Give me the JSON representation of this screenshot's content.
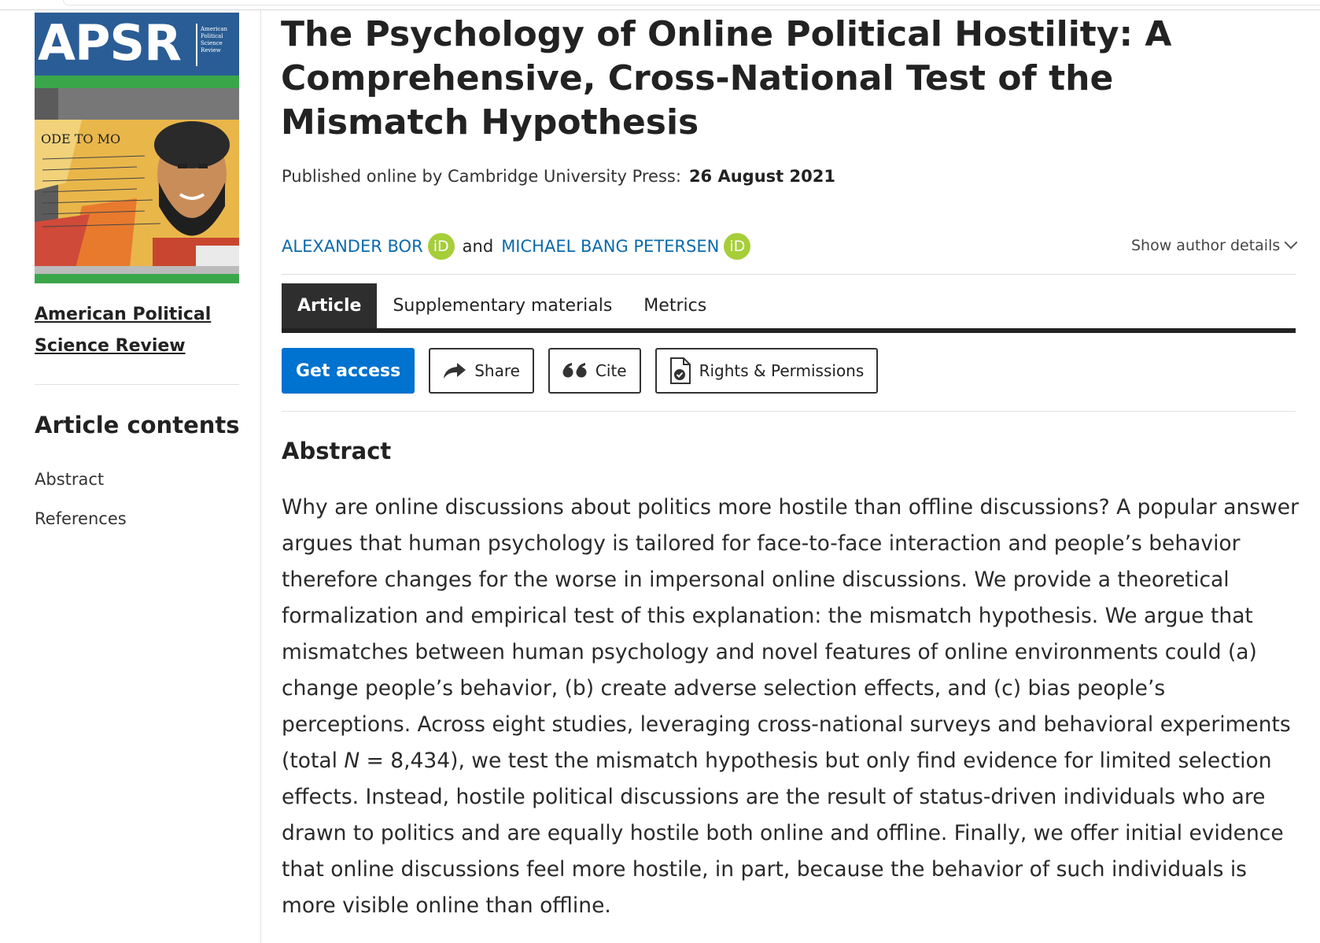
{
  "journal": {
    "cover_brand": "APSR",
    "cover_subtitle": "American Political Science Review",
    "name_line1": "American Political",
    "name_line2": "Science Review"
  },
  "sidebar": {
    "contents_heading": "Article contents",
    "items": [
      {
        "label": "Abstract"
      },
      {
        "label": "References"
      }
    ]
  },
  "article": {
    "title": "The Psychology of Online Political Hostility: A Comprehensive, Cross-National Test of the Mismatch Hypothesis",
    "published_label": "Published online by Cambridge University Press:",
    "published_date": "26 August 2021",
    "authors": [
      {
        "name": "ALEXANDER BOR",
        "orcid": "iD"
      },
      {
        "name": "MICHAEL BANG PETERSEN",
        "orcid": "iD"
      }
    ],
    "authors_joiner": "and",
    "show_author_details": "Show author details"
  },
  "tabs": [
    {
      "label": "Article",
      "active": true
    },
    {
      "label": "Supplementary materials",
      "active": false
    },
    {
      "label": "Metrics",
      "active": false
    }
  ],
  "actions": {
    "get_access": "Get access",
    "share": "Share",
    "cite": "Cite",
    "rights": "Rights & Permissions"
  },
  "abstract": {
    "heading": "Abstract",
    "text_before_n": "Why are online discussions about politics more hostile than offline discussions? A popular answer argues that human psychology is tailored for face-to-face interaction and people’s behavior therefore changes for the worse in impersonal online discussions. We provide a theoretical formalization and empirical test of this explanation: the mismatch hypothesis. We argue that mismatches between human psychology and novel features of online environments could (a) change people’s behavior, (b) create adverse selection effects, and (c) bias people’s perceptions. Across eight studies, leveraging cross-national surveys and behavioral experiments (total ",
    "n_symbol": "N",
    "text_after_n": " = 8,434), we test the mismatch hypothesis but only find evidence for limited selection effects. Instead, hostile political discussions are the result of status-driven individuals who are drawn to politics and are equally hostile both online and offline. Finally, we offer initial evidence that online discussions feel more hostile, in part, because the behavior of such individuals is more visible online than offline."
  },
  "colors": {
    "link_blue": "#0b6aa9",
    "primary_button": "#0072cf",
    "orcid_green": "#a6ce39",
    "tab_active": "#2e2e2e",
    "cover_band": "#2a5d95"
  },
  "icons": {
    "share": "share-arrow-icon",
    "cite": "quote-icon",
    "rights": "document-check-icon",
    "author_details": "chevron-down-icon"
  }
}
